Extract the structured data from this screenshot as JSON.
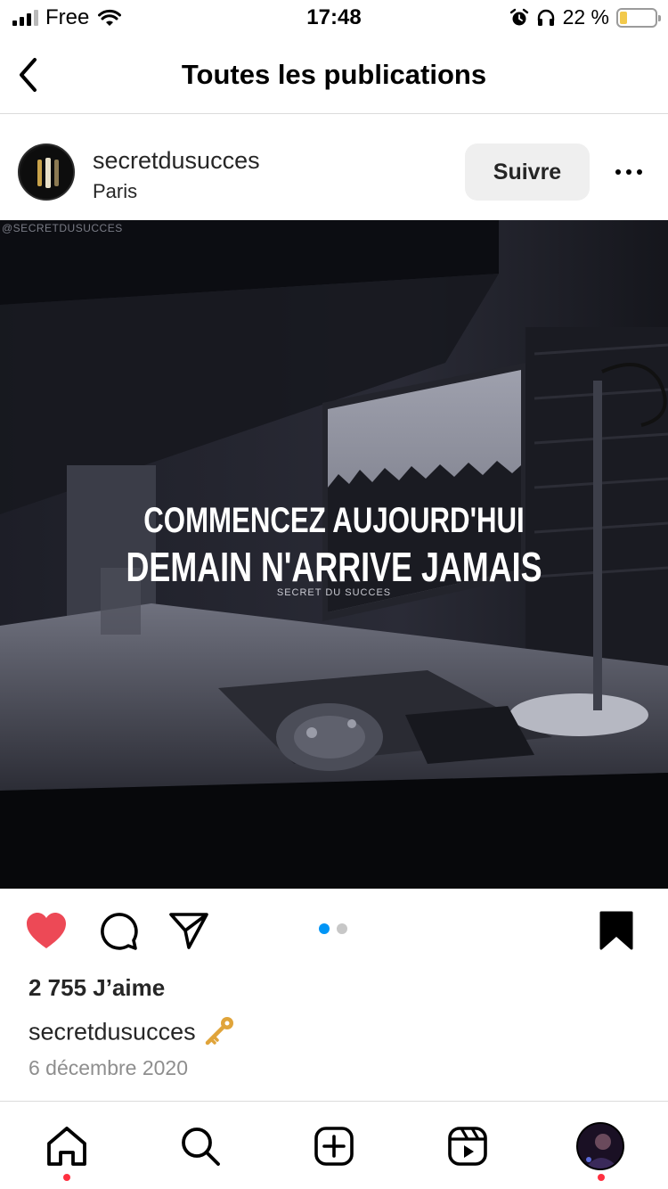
{
  "status_bar": {
    "carrier": "Free",
    "time": "17:48",
    "battery_percent": "22 %",
    "battery_level": 0.22,
    "icons": [
      "signal-icon",
      "wifi-icon",
      "alarm-icon",
      "headphones-icon",
      "battery-icon"
    ]
  },
  "header": {
    "back_icon": "chevron-left-icon",
    "title": "Toutes les publications"
  },
  "post": {
    "username": "secretdusucces",
    "location": "Paris",
    "follow_label": "Suivre",
    "more_icon": "more-horizontal-icon",
    "image": {
      "watermark": "@SECRETDUSUCCES",
      "quote_line1": "COMMENCEZ AUJOURD'HUI",
      "quote_line2": "DEMAIN N'ARRIVE JAMAIS",
      "signature": "SECRET DU SUCCES"
    },
    "carousel": {
      "count": 2,
      "active_index": 0
    },
    "likes": "2 755 J’aime",
    "caption_user": "secretdusucces",
    "caption_emoji": "key-icon",
    "date": "6 décembre 2020",
    "liked": true,
    "saved": true
  },
  "actions": {
    "icons": [
      "heart-icon",
      "comment-icon",
      "share-icon",
      "bookmark-icon"
    ]
  },
  "colors": {
    "like_red": "#ed4956",
    "carousel_active": "#0095f6",
    "carousel_inactive": "#c7c7c7",
    "notification_dot": "#ff3040"
  },
  "tab_bar": {
    "tabs": [
      "home-icon",
      "search-icon",
      "create-icon",
      "reels-icon",
      "profile-avatar"
    ]
  }
}
